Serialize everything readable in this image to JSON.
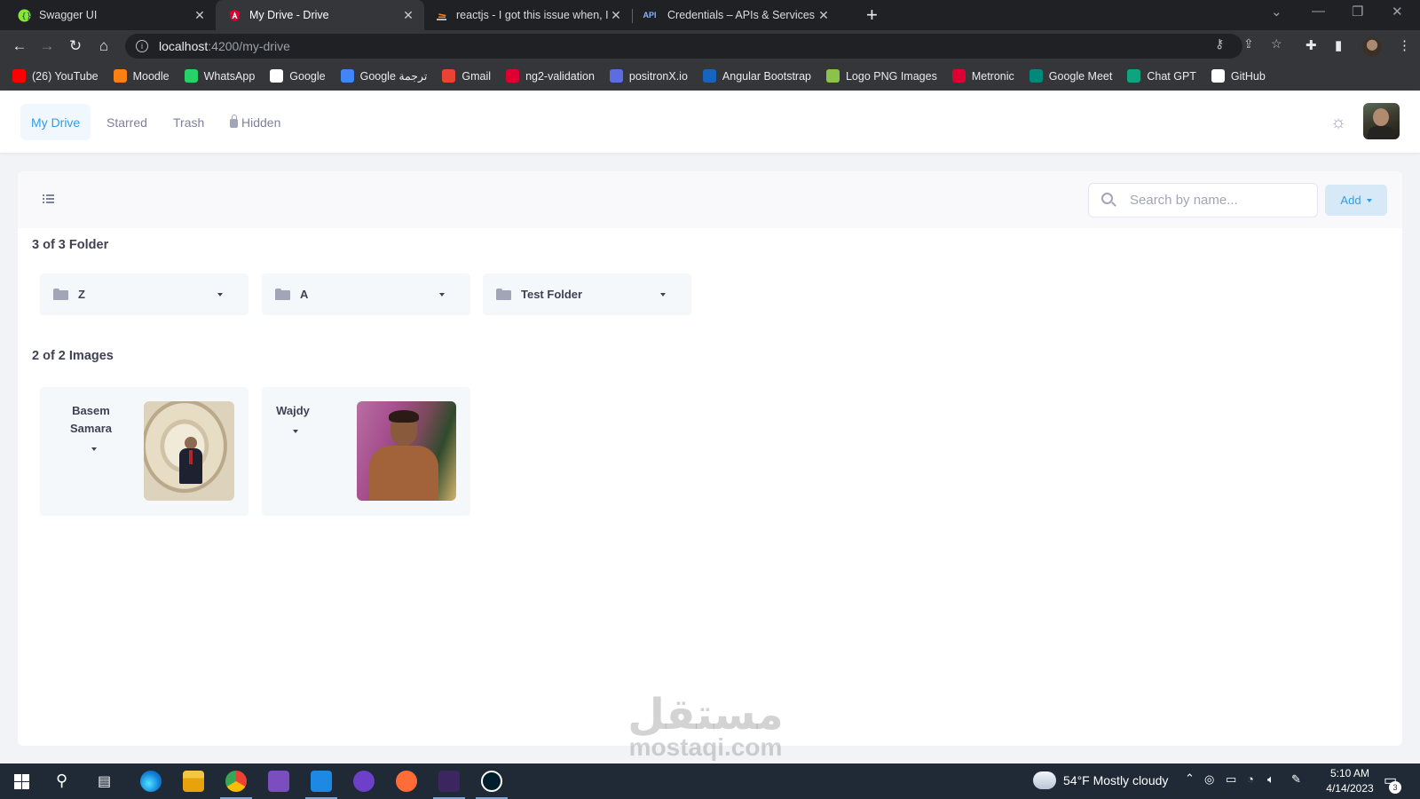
{
  "browser": {
    "tabs": [
      {
        "title": "Swagger UI",
        "active": false,
        "favicon_color": "#85ea2d"
      },
      {
        "title": "My Drive - Drive",
        "active": true,
        "favicon_color": "#dd0031"
      },
      {
        "title": "reactjs - I got this issue when, I a",
        "active": false,
        "favicon_color": "#f48024"
      },
      {
        "title": "Credentials – APIs & Services – M",
        "active": false,
        "favicon_color": "#8ab4f8"
      }
    ],
    "url_host": "localhost",
    "url_path": ":4200/my-drive",
    "bookmarks": [
      {
        "label": "(26) YouTube",
        "icon": "youtube-icon",
        "color": "#ff0000"
      },
      {
        "label": "Moodle",
        "icon": "moodle-icon",
        "color": "#f98012"
      },
      {
        "label": "WhatsApp",
        "icon": "whatsapp-icon",
        "color": "#25d366"
      },
      {
        "label": "Google",
        "icon": "google-icon",
        "color": "#ffffff"
      },
      {
        "label": "Google ترجمة",
        "icon": "google-translate-icon",
        "color": "#4285f4"
      },
      {
        "label": "Gmail",
        "icon": "gmail-icon",
        "color": "#ea4335"
      },
      {
        "label": "ng2-validation",
        "icon": "ng2-icon",
        "color": "#dd0031"
      },
      {
        "label": "positronX.io",
        "icon": "positronx-icon",
        "color": "#5b6ee1"
      },
      {
        "label": "Angular Bootstrap",
        "icon": "bootstrap-icon",
        "color": "#1565c0"
      },
      {
        "label": "Logo PNG Images",
        "icon": "logo-png-icon",
        "color": "#8bc34a"
      },
      {
        "label": "Metronic",
        "icon": "metronic-icon",
        "color": "#dd0031"
      },
      {
        "label": "Google Meet",
        "icon": "google-meet-icon",
        "color": "#00897b"
      },
      {
        "label": "Chat GPT",
        "icon": "chatgpt-icon",
        "color": "#10a37f"
      },
      {
        "label": "GitHub",
        "icon": "github-icon",
        "color": "#ffffff"
      }
    ]
  },
  "app": {
    "nav": [
      {
        "label": "My Drive",
        "active": true
      },
      {
        "label": "Starred",
        "active": false
      },
      {
        "label": "Trash",
        "active": false
      },
      {
        "label": "Hidden",
        "active": false,
        "icon": "lock-icon"
      }
    ],
    "accent_color": "#2f9ee4",
    "search": {
      "placeholder": "Search by name..."
    },
    "add_label": "Add",
    "folders_title": "3 of 3 Folder",
    "folders": [
      {
        "name": "Z"
      },
      {
        "name": "A"
      },
      {
        "name": "Test Folder"
      }
    ],
    "images_title": "2 of 2 Images",
    "images": [
      {
        "name_line1": "Basem",
        "name_line2": "Samara"
      },
      {
        "name_line1": "Wajdy",
        "name_line2": ""
      }
    ],
    "watermark_ar": "مستقل",
    "watermark_latin": "mostaqi.com"
  },
  "taskbar": {
    "weather": "54°F  Mostly cloudy",
    "time": "5:10 AM",
    "date": "4/14/2023",
    "notifications": "3"
  }
}
